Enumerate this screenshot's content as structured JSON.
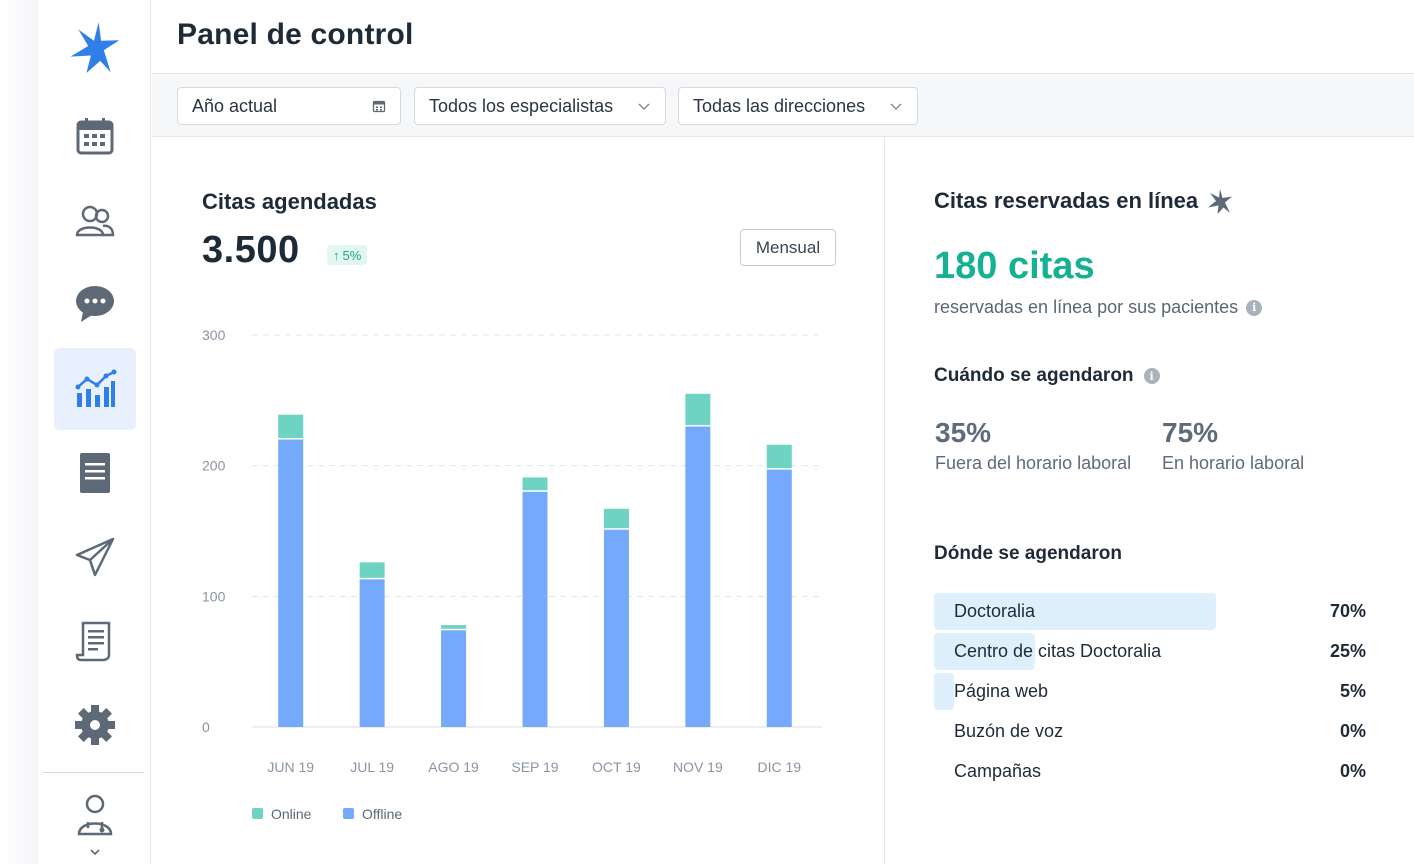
{
  "header": {
    "title": "Panel de control"
  },
  "filters": [
    {
      "label": "Año actual",
      "icon": "calendar-icon"
    },
    {
      "label": "Todos los especialistas",
      "icon": "chevron-down-icon"
    },
    {
      "label": "Todas las direcciones",
      "icon": "chevron-down-icon"
    }
  ],
  "sidebar": {
    "items": [
      {
        "name": "calendar",
        "icon": "calendar-icon"
      },
      {
        "name": "patients",
        "icon": "users-icon"
      },
      {
        "name": "messages",
        "icon": "chat-icon"
      },
      {
        "name": "statistics",
        "icon": "analytics-icon",
        "active": true
      },
      {
        "name": "documents",
        "icon": "document-icon"
      },
      {
        "name": "campaigns",
        "icon": "paper-plane-icon"
      },
      {
        "name": "invoices",
        "icon": "receipt-icon"
      },
      {
        "name": "settings",
        "icon": "gear-icon"
      }
    ],
    "profile_icon": "doctor-avatar-icon"
  },
  "appointments": {
    "title": "Citas agendadas",
    "total": "3.500",
    "growth": "5%",
    "period_button": "Mensual"
  },
  "chart_data": {
    "type": "bar",
    "stacked": true,
    "categories": [
      "JUN 19",
      "JUL 19",
      "AGO 19",
      "SEP 19",
      "OCT 19",
      "NOV 19",
      "DIC 19"
    ],
    "series": [
      {
        "name": "Offline",
        "color": "#74a9fc",
        "values": [
          220,
          113,
          74,
          180,
          151,
          230,
          197
        ]
      },
      {
        "name": "Online",
        "color": "#6ed3c3",
        "values": [
          19,
          13,
          4,
          11,
          16,
          25,
          19
        ]
      }
    ],
    "yticks": [
      0,
      100,
      200,
      300
    ],
    "ylim": [
      0,
      300
    ],
    "grid": true,
    "legend": "bottom-left"
  },
  "online": {
    "title": "Citas reservadas en línea",
    "count": "180 citas",
    "subtitle": "reservadas en línea por sus pacientes",
    "when_title": "Cuándo se agendaron",
    "when": [
      {
        "pct": "35%",
        "label": "Fuera del horario laboral"
      },
      {
        "pct": "75%",
        "label": "En horario laboral"
      }
    ],
    "where_title": "Dónde se agendaron",
    "where": [
      {
        "label": "Doctoralia",
        "pct": "70%",
        "value": 0.7
      },
      {
        "label": "Centro de citas Doctoralia",
        "pct": "25%",
        "value": 0.25
      },
      {
        "label": "Página web",
        "pct": "5%",
        "value": 0.05
      },
      {
        "label": "Buzón de voz",
        "pct": "0%",
        "value": 0
      },
      {
        "label": "Campañas",
        "pct": "0%",
        "value": 0
      }
    ]
  },
  "colors": {
    "accent": "#16b193",
    "brand_blue": "#2f7fe6",
    "offline": "#74a9fc",
    "online": "#6ed3c3"
  }
}
